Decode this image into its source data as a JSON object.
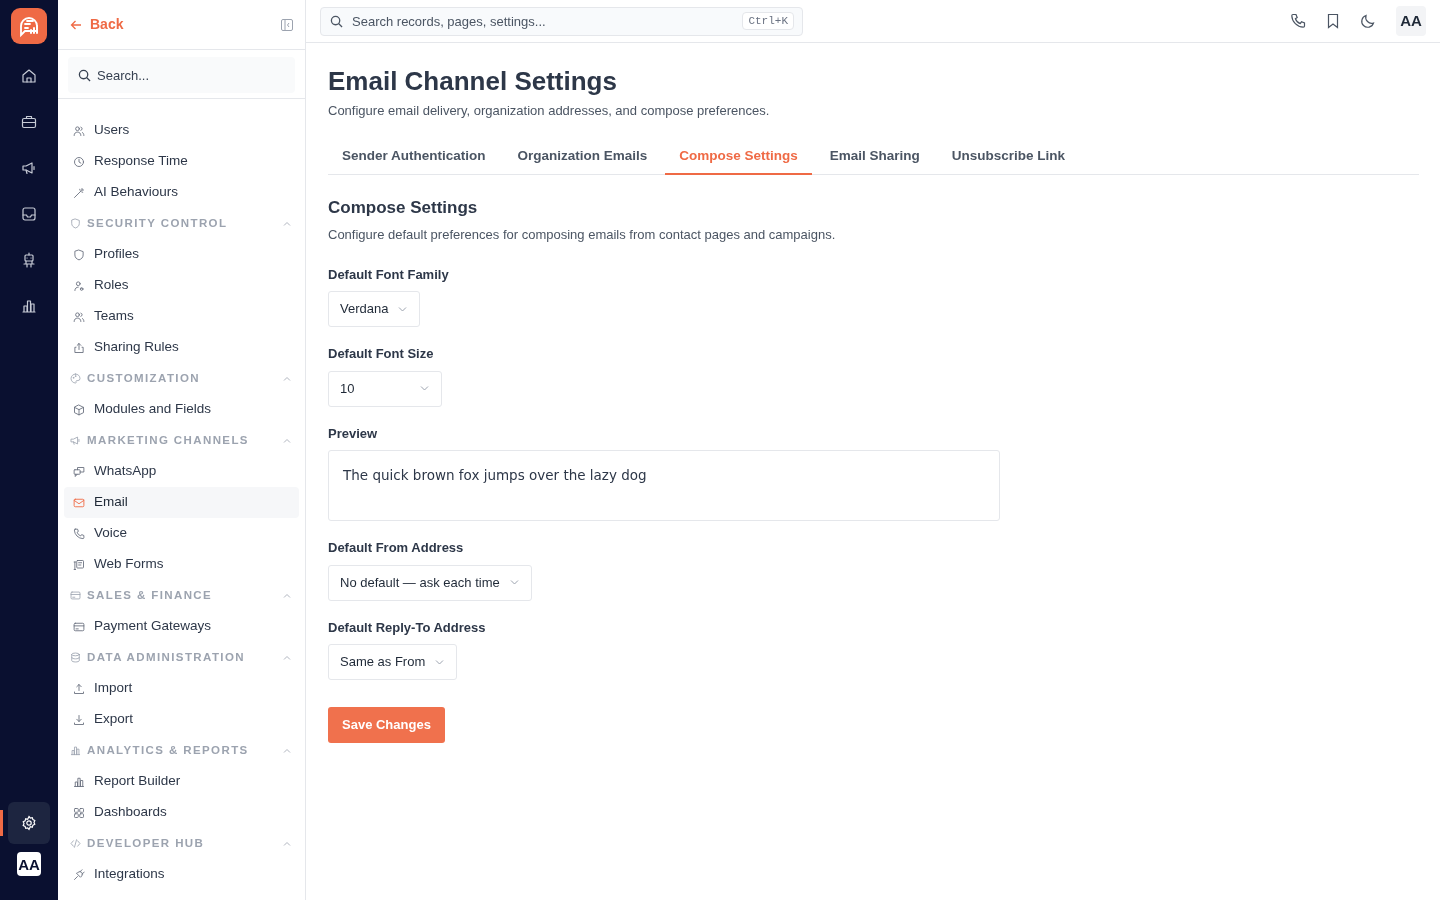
{
  "topbar": {
    "back": "Back",
    "search_placeholder": "Search records, pages, settings...",
    "shortcut": "Ctrl+K",
    "avatar": "AA"
  },
  "rail": {
    "items": [
      {
        "selected": false
      },
      {
        "selected": false
      },
      {
        "selected": false
      },
      {
        "selected": false
      },
      {
        "selected": false
      },
      {
        "selected": false
      }
    ],
    "settings_selected": true,
    "avatar": "AA"
  },
  "sidebar": {
    "search_placeholder": "Search...",
    "items": [
      {
        "kind": "item",
        "label": "Users",
        "selected": false
      },
      {
        "kind": "item",
        "label": "Response Time",
        "selected": false
      },
      {
        "kind": "item",
        "label": "AI Behaviours",
        "selected": false
      },
      {
        "kind": "section",
        "label": "SECURITY CONTROL",
        "expanded": true
      },
      {
        "kind": "item",
        "label": "Profiles",
        "selected": false
      },
      {
        "kind": "item",
        "label": "Roles",
        "selected": false
      },
      {
        "kind": "item",
        "label": "Teams",
        "selected": false
      },
      {
        "kind": "item",
        "label": "Sharing Rules",
        "selected": false
      },
      {
        "kind": "section",
        "label": "CUSTOMIZATION",
        "expanded": true
      },
      {
        "kind": "item",
        "label": "Modules and Fields",
        "selected": false
      },
      {
        "kind": "section",
        "label": "MARKETING CHANNELS",
        "expanded": true
      },
      {
        "kind": "item",
        "label": "WhatsApp",
        "selected": false
      },
      {
        "kind": "item",
        "label": "Email",
        "selected": true
      },
      {
        "kind": "item",
        "label": "Voice",
        "selected": false
      },
      {
        "kind": "item",
        "label": "Web Forms",
        "selected": false
      },
      {
        "kind": "section",
        "label": "SALES & FINANCE",
        "expanded": true
      },
      {
        "kind": "item",
        "label": "Payment Gateways",
        "selected": false
      },
      {
        "kind": "section",
        "label": "DATA ADMINISTRATION",
        "expanded": true
      },
      {
        "kind": "item",
        "label": "Import",
        "selected": false
      },
      {
        "kind": "item",
        "label": "Export",
        "selected": false
      },
      {
        "kind": "section",
        "label": "ANALYTICS & REPORTS",
        "expanded": true
      },
      {
        "kind": "item",
        "label": "Report Builder",
        "selected": false
      },
      {
        "kind": "item",
        "label": "Dashboards",
        "selected": false
      },
      {
        "kind": "section",
        "label": "DEVELOPER HUB",
        "expanded": true
      },
      {
        "kind": "item",
        "label": "Integrations",
        "selected": false
      }
    ]
  },
  "page": {
    "title": "Email Channel Settings",
    "subtitle": "Configure email delivery, organization addresses, and compose preferences.",
    "tabs": [
      {
        "label": "Sender Authentication",
        "selected": false
      },
      {
        "label": "Organization Emails",
        "selected": false
      },
      {
        "label": "Compose Settings",
        "selected": true
      },
      {
        "label": "Email Sharing",
        "selected": false
      },
      {
        "label": "Unsubscribe Link",
        "selected": false
      }
    ],
    "section_title": "Compose Settings",
    "section_subtitle": "Configure default preferences for composing emails from contact pages and campaigns.",
    "fields": [
      {
        "kind": "select",
        "label": "Default Font Family",
        "value": "Verdana"
      },
      {
        "kind": "select",
        "label": "Default Font Size",
        "value": "10"
      },
      {
        "kind": "preview",
        "label": "Preview",
        "value": "The quick brown fox jumps over the lazy dog"
      },
      {
        "kind": "select",
        "label": "Default From Address",
        "value": "No default — ask each time"
      },
      {
        "kind": "select",
        "label": "Default Reply-To Address",
        "value": "Same as From"
      }
    ],
    "save": "Save Changes"
  }
}
